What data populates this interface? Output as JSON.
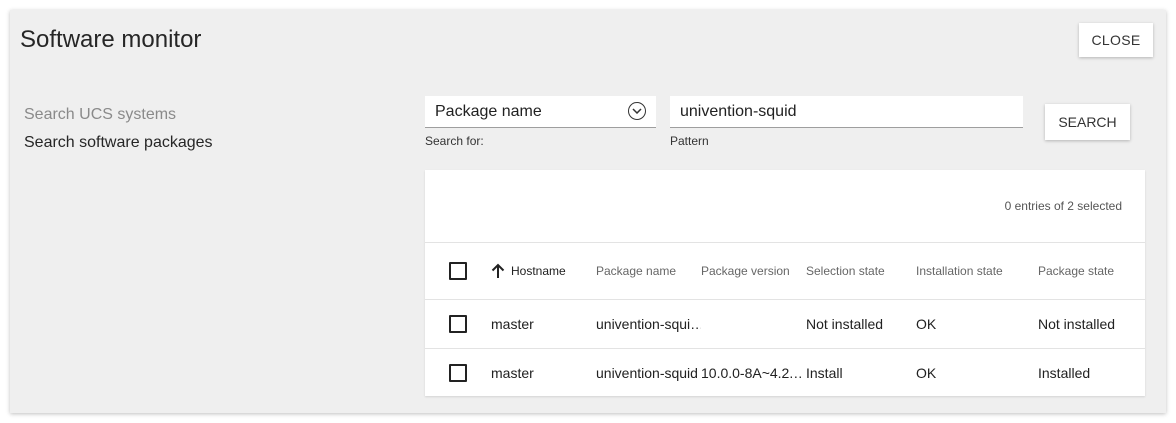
{
  "dialog": {
    "title": "Software monitor",
    "close_label": "CLOSE"
  },
  "sidebar": {
    "items": [
      {
        "label": "Search UCS systems",
        "active": false
      },
      {
        "label": "Search software packages",
        "active": true
      }
    ]
  },
  "search": {
    "search_for_value": "Package name",
    "search_for_label": "Search for:",
    "pattern_value": "univention-squid",
    "pattern_label": "Pattern",
    "button_label": "SEARCH"
  },
  "grid": {
    "status": "0 entries of 2 selected",
    "columns": [
      "Hostname",
      "Package name",
      "Package version",
      "Selection state",
      "Installation state",
      "Package state"
    ],
    "sorted_column": "Hostname",
    "sort_direction": "ascending",
    "rows": [
      {
        "hostname": "master",
        "package_name": "univention-squi…",
        "package_version": "",
        "selection_state": "Not installed",
        "installation_state": "OK",
        "package_state": "Not installed"
      },
      {
        "hostname": "master",
        "package_name": "univention-squid",
        "package_version": "10.0.0-8A~4.2.…",
        "selection_state": "Install",
        "installation_state": "OK",
        "package_state": "Installed"
      }
    ]
  }
}
